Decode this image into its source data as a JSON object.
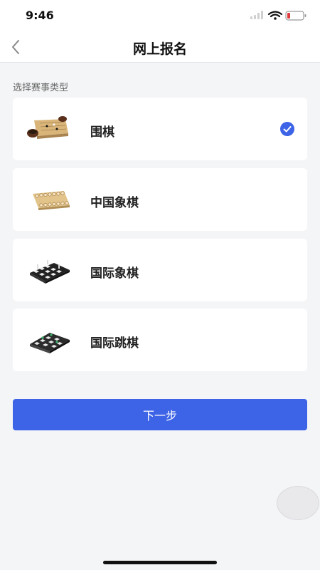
{
  "status_bar": {
    "time": "9:46"
  },
  "header": {
    "title": "网上报名",
    "back_icon": "chevron-left-icon"
  },
  "section_label": "选择赛事类型",
  "options": [
    {
      "label": "围棋",
      "icon": "go-board-icon",
      "selected": true
    },
    {
      "label": "中国象棋",
      "icon": "xiangqi-board-icon",
      "selected": false
    },
    {
      "label": "国际象棋",
      "icon": "chess-board-icon",
      "selected": false
    },
    {
      "label": "国际跳棋",
      "icon": "draughts-board-icon",
      "selected": false
    }
  ],
  "next_button": {
    "label": "下一步"
  },
  "colors": {
    "accent": "#3d63e6",
    "background": "#f4f5f7",
    "card": "#ffffff"
  }
}
